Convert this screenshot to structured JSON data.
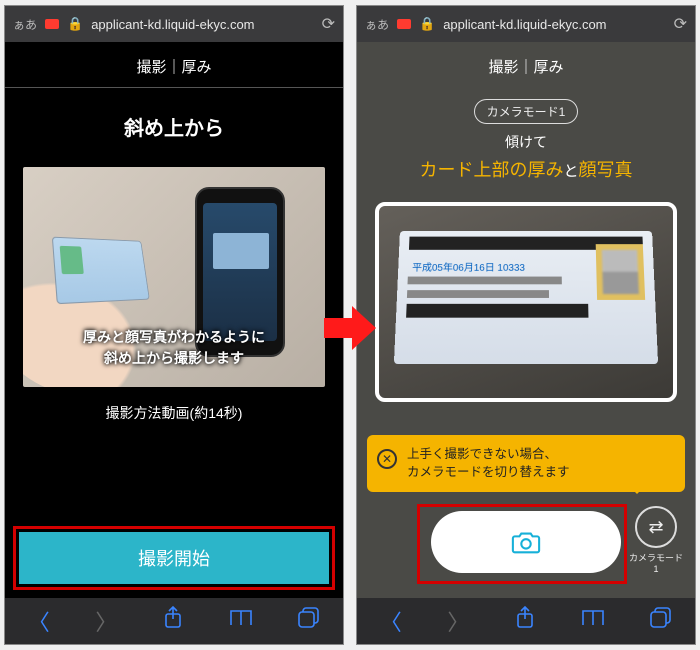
{
  "url": "applicant-kd.liquid-ekyc.com",
  "urlbar_aa": "ぁあ",
  "header_title": "撮影｜厚み",
  "left": {
    "instruction_title": "斜め上から",
    "overlay_line1": "厚みと顔写真がわかるように",
    "overlay_line2": "斜め上から撮影します",
    "video_caption": "撮影方法動画(約14秒)",
    "start_button": "撮影開始"
  },
  "right": {
    "camera_mode_pill": "カメラモード1",
    "tilt_label": "傾けて",
    "thickness_prefix": "カード上部の厚み",
    "thickness_joiner": "と",
    "thickness_suffix": "顔写真",
    "id_sample_date": "平成05年06月16日  10333",
    "hint_line1": "上手く撮影できない場合、",
    "hint_line2": "カメラモードを切り替えます",
    "mode_switch_label": "カメラモード1"
  }
}
